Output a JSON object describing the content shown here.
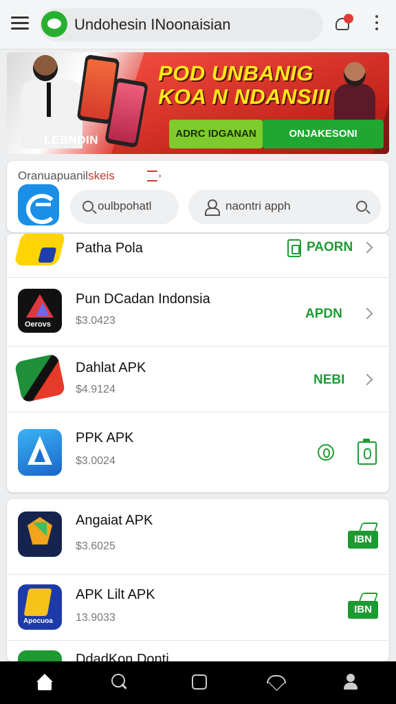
{
  "header": {
    "title": "Undohesin INoonaisian",
    "notification_count": "",
    "icons": [
      "menu-icon",
      "app-logo-icon",
      "notification-icon",
      "more-icon"
    ]
  },
  "banner": {
    "headline": "POD UNBANIG KOA N NDANSIII",
    "left_label": "LEBNDIN",
    "button_primary": "ADRC IDGANAN",
    "button_secondary": "ONJAKESONI"
  },
  "search": {
    "section_label_a": "Oranuapuanil",
    "section_label_b": "skeis",
    "chip_1": "oulbpohatl",
    "chip_2": "naontri apph"
  },
  "apps": [
    {
      "name": "Patha Pola",
      "price": "",
      "action": "PAORN"
    },
    {
      "name": "Pun DCadan Indonsia",
      "price": "$3.0423",
      "action": "APDN",
      "icon_sub": "Oerovs"
    },
    {
      "name": "Dahlat APK",
      "price": "$4.9124",
      "action": "NEBI"
    },
    {
      "name": "PPK APK",
      "price": "$3.0024",
      "action": ""
    },
    {
      "name": "Angaiat APK",
      "price": "$3.6025",
      "action": "IBN"
    },
    {
      "name": "APK Lilt APK",
      "price": "13.9033",
      "action": "IBN",
      "icon_sub": "Apocuoa"
    },
    {
      "name": "DdadKon Donti",
      "price": "",
      "action": ""
    }
  ],
  "colors": {
    "accent_green": "#1e9a32",
    "banner_red": "#c81f1a",
    "headline_yellow": "#ffe81a"
  },
  "nav": [
    "home-icon",
    "search-icon",
    "apps-icon",
    "favorites-icon",
    "profile-icon"
  ]
}
